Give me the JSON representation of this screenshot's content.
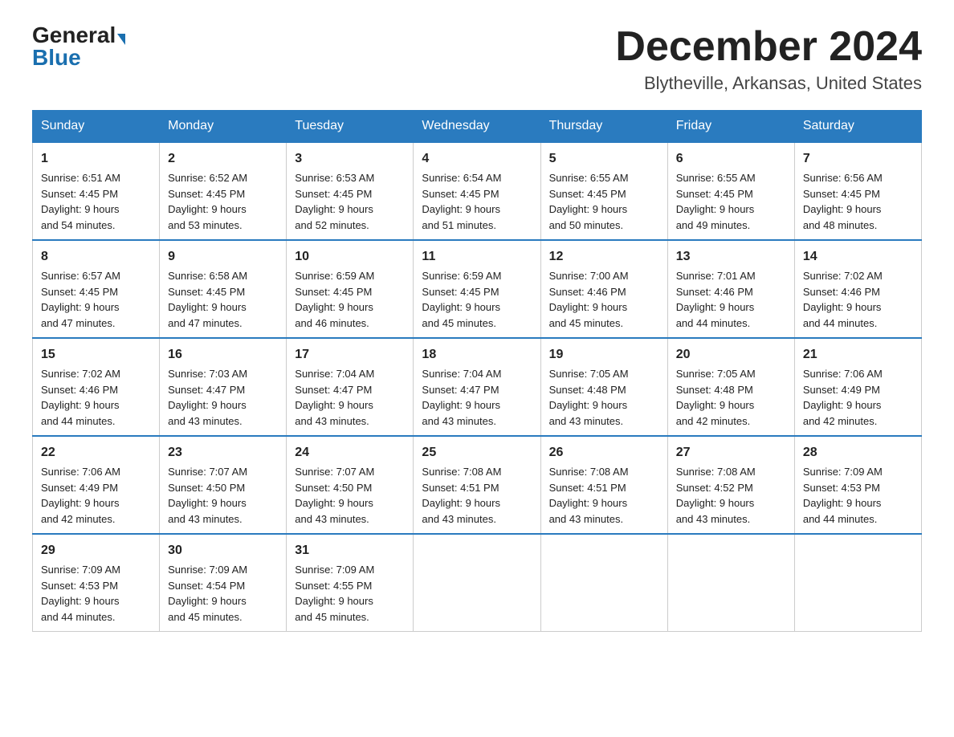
{
  "header": {
    "logo_general": "General",
    "logo_blue": "Blue",
    "month_title": "December 2024",
    "location": "Blytheville, Arkansas, United States"
  },
  "days_of_week": [
    "Sunday",
    "Monday",
    "Tuesday",
    "Wednesday",
    "Thursday",
    "Friday",
    "Saturday"
  ],
  "weeks": [
    [
      {
        "day": "1",
        "sunrise": "6:51 AM",
        "sunset": "4:45 PM",
        "daylight": "9 hours and 54 minutes."
      },
      {
        "day": "2",
        "sunrise": "6:52 AM",
        "sunset": "4:45 PM",
        "daylight": "9 hours and 53 minutes."
      },
      {
        "day": "3",
        "sunrise": "6:53 AM",
        "sunset": "4:45 PM",
        "daylight": "9 hours and 52 minutes."
      },
      {
        "day": "4",
        "sunrise": "6:54 AM",
        "sunset": "4:45 PM",
        "daylight": "9 hours and 51 minutes."
      },
      {
        "day": "5",
        "sunrise": "6:55 AM",
        "sunset": "4:45 PM",
        "daylight": "9 hours and 50 minutes."
      },
      {
        "day": "6",
        "sunrise": "6:55 AM",
        "sunset": "4:45 PM",
        "daylight": "9 hours and 49 minutes."
      },
      {
        "day": "7",
        "sunrise": "6:56 AM",
        "sunset": "4:45 PM",
        "daylight": "9 hours and 48 minutes."
      }
    ],
    [
      {
        "day": "8",
        "sunrise": "6:57 AM",
        "sunset": "4:45 PM",
        "daylight": "9 hours and 47 minutes."
      },
      {
        "day": "9",
        "sunrise": "6:58 AM",
        "sunset": "4:45 PM",
        "daylight": "9 hours and 47 minutes."
      },
      {
        "day": "10",
        "sunrise": "6:59 AM",
        "sunset": "4:45 PM",
        "daylight": "9 hours and 46 minutes."
      },
      {
        "day": "11",
        "sunrise": "6:59 AM",
        "sunset": "4:45 PM",
        "daylight": "9 hours and 45 minutes."
      },
      {
        "day": "12",
        "sunrise": "7:00 AM",
        "sunset": "4:46 PM",
        "daylight": "9 hours and 45 minutes."
      },
      {
        "day": "13",
        "sunrise": "7:01 AM",
        "sunset": "4:46 PM",
        "daylight": "9 hours and 44 minutes."
      },
      {
        "day": "14",
        "sunrise": "7:02 AM",
        "sunset": "4:46 PM",
        "daylight": "9 hours and 44 minutes."
      }
    ],
    [
      {
        "day": "15",
        "sunrise": "7:02 AM",
        "sunset": "4:46 PM",
        "daylight": "9 hours and 44 minutes."
      },
      {
        "day": "16",
        "sunrise": "7:03 AM",
        "sunset": "4:47 PM",
        "daylight": "9 hours and 43 minutes."
      },
      {
        "day": "17",
        "sunrise": "7:04 AM",
        "sunset": "4:47 PM",
        "daylight": "9 hours and 43 minutes."
      },
      {
        "day": "18",
        "sunrise": "7:04 AM",
        "sunset": "4:47 PM",
        "daylight": "9 hours and 43 minutes."
      },
      {
        "day": "19",
        "sunrise": "7:05 AM",
        "sunset": "4:48 PM",
        "daylight": "9 hours and 43 minutes."
      },
      {
        "day": "20",
        "sunrise": "7:05 AM",
        "sunset": "4:48 PM",
        "daylight": "9 hours and 42 minutes."
      },
      {
        "day": "21",
        "sunrise": "7:06 AM",
        "sunset": "4:49 PM",
        "daylight": "9 hours and 42 minutes."
      }
    ],
    [
      {
        "day": "22",
        "sunrise": "7:06 AM",
        "sunset": "4:49 PM",
        "daylight": "9 hours and 42 minutes."
      },
      {
        "day": "23",
        "sunrise": "7:07 AM",
        "sunset": "4:50 PM",
        "daylight": "9 hours and 43 minutes."
      },
      {
        "day": "24",
        "sunrise": "7:07 AM",
        "sunset": "4:50 PM",
        "daylight": "9 hours and 43 minutes."
      },
      {
        "day": "25",
        "sunrise": "7:08 AM",
        "sunset": "4:51 PM",
        "daylight": "9 hours and 43 minutes."
      },
      {
        "day": "26",
        "sunrise": "7:08 AM",
        "sunset": "4:51 PM",
        "daylight": "9 hours and 43 minutes."
      },
      {
        "day": "27",
        "sunrise": "7:08 AM",
        "sunset": "4:52 PM",
        "daylight": "9 hours and 43 minutes."
      },
      {
        "day": "28",
        "sunrise": "7:09 AM",
        "sunset": "4:53 PM",
        "daylight": "9 hours and 44 minutes."
      }
    ],
    [
      {
        "day": "29",
        "sunrise": "7:09 AM",
        "sunset": "4:53 PM",
        "daylight": "9 hours and 44 minutes."
      },
      {
        "day": "30",
        "sunrise": "7:09 AM",
        "sunset": "4:54 PM",
        "daylight": "9 hours and 45 minutes."
      },
      {
        "day": "31",
        "sunrise": "7:09 AM",
        "sunset": "4:55 PM",
        "daylight": "9 hours and 45 minutes."
      },
      null,
      null,
      null,
      null
    ]
  ],
  "labels": {
    "sunrise": "Sunrise:",
    "sunset": "Sunset:",
    "daylight": "Daylight:"
  }
}
